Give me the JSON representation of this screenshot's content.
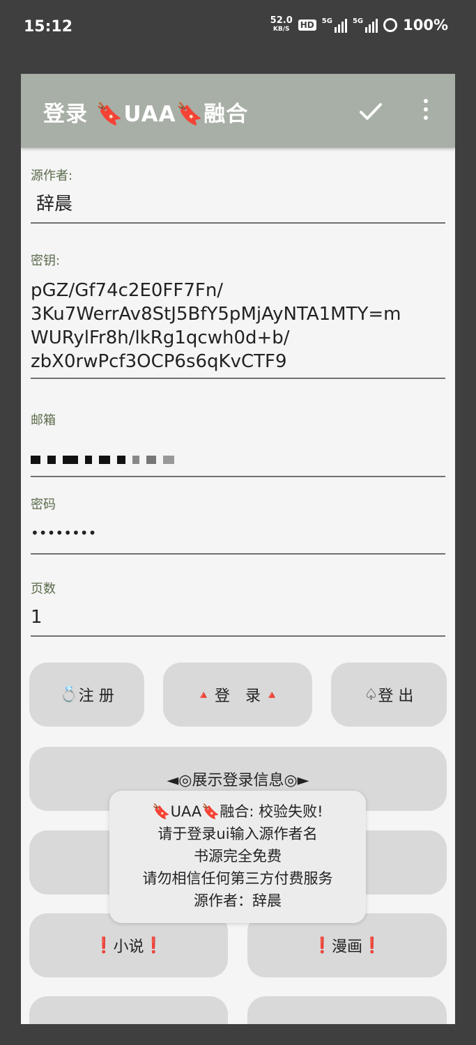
{
  "status_bar": {
    "time": "15:12",
    "net_speed": "52.0",
    "net_unit": "KB/S",
    "hd": "HD",
    "sig1_label": "5G",
    "sig2_label": "5G",
    "battery": "100%"
  },
  "dialog": {
    "title": "登录 🔖UAA🔖融合",
    "actions": {
      "confirm_icon": "check-icon",
      "more_icon": "more-vert-icon"
    }
  },
  "fields": {
    "author": {
      "label": "源作者:",
      "value": "辞晨"
    },
    "secret": {
      "label": "密钥:",
      "lines": [
        "pGZ/Gf74c2E0FF7Fn/",
        "3Ku7WerrAv8StJ5BfY5pMjAyNTA1MTY=m",
        "WURylFr8h/lkRg1qcwh0d+b/",
        "zbX0rwPcf3OCP6s6qKvCTF9"
      ]
    },
    "email": {
      "label": "邮箱"
    },
    "password": {
      "label": "密码",
      "value": "••••••••"
    },
    "pages": {
      "label": "页数",
      "value": "1"
    }
  },
  "buttons": {
    "register": {
      "icon": "💍",
      "label": "注 册"
    },
    "login": {
      "left_icon": "🔺",
      "label": "登　录",
      "right_icon": "🔺"
    },
    "logout": {
      "icon": "♤",
      "label": "登 出"
    },
    "show_info": "◄◎展示登录信息◎►",
    "novel": {
      "left": "❗",
      "label": "小说",
      "right": "❗"
    },
    "comic": {
      "left": "❗",
      "label": "漫画",
      "right": "❗"
    }
  },
  "toast": {
    "lines": [
      "🔖UAA🔖融合: 校验失败!",
      "请于登录ui输入源作者名",
      "书源完全免费",
      "请勿相信任何第三方付费服务",
      "源作者：辞晨"
    ]
  }
}
